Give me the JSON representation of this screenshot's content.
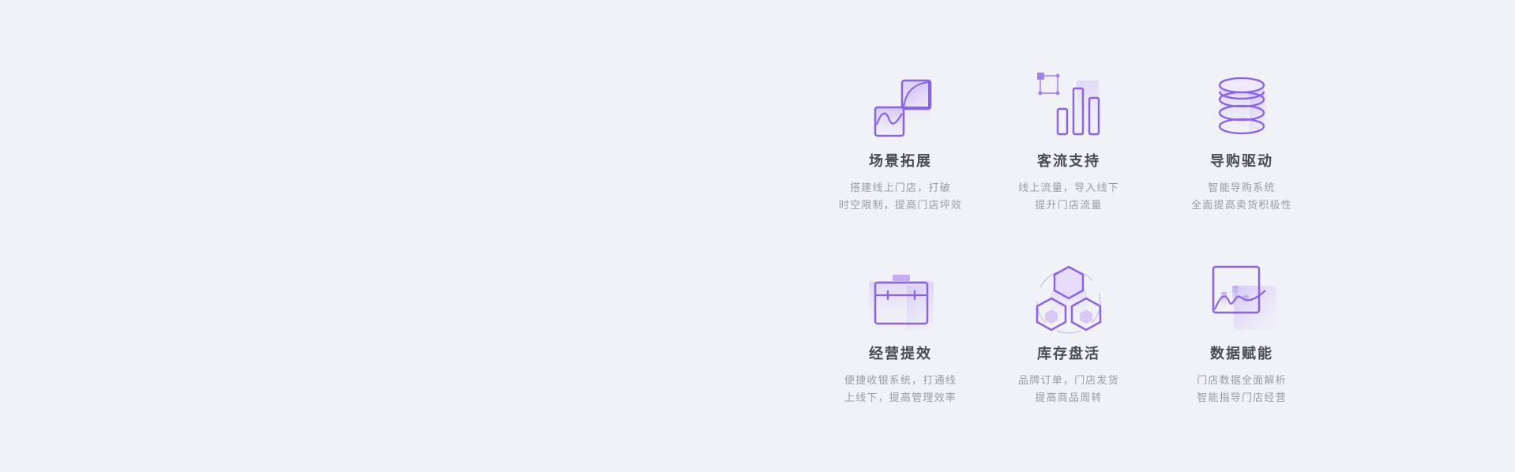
{
  "features": [
    {
      "title": "场景拓展",
      "desc_line1": "搭建线上门店，打破",
      "desc_line2": "时空限制，提高门店坪效",
      "icon": "scene-expand-icon"
    },
    {
      "title": "客流支持",
      "desc_line1": "线上流量，导入线下",
      "desc_line2": "提升门店流量",
      "icon": "traffic-chart-icon"
    },
    {
      "title": "导购驱动",
      "desc_line1": "智能导购系统",
      "desc_line2": "全面提高卖货积极性",
      "icon": "coin-stack-icon"
    },
    {
      "title": "经营提效",
      "desc_line1": "便捷收银系统，打通线",
      "desc_line2": "上线下，提高管理效率",
      "icon": "briefcase-icon"
    },
    {
      "title": "库存盘活",
      "desc_line1": "品牌订单，门店发货",
      "desc_line2": "提高商品周转",
      "icon": "hexagon-cluster-icon"
    },
    {
      "title": "数据赋能",
      "desc_line1": "门店数据全面解析",
      "desc_line2": "智能指导门店经营",
      "icon": "data-trend-icon"
    }
  ],
  "colors": {
    "accent": "#8a63e6",
    "accent_light": "#cbb8f5",
    "title": "#4a4b55",
    "desc": "#9a9ba6",
    "background": "#f1f2f7"
  }
}
